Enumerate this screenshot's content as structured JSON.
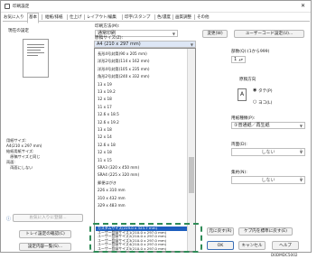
{
  "window": {
    "title": "印刷設定"
  },
  "tabs": [
    "お気に入り",
    "基本",
    "給紙/排紙",
    "仕上げ",
    "レイアウト/編集",
    "印字/スタンプ",
    "色/濃度",
    "画質調整",
    "その他"
  ],
  "current_settings": {
    "title": "現在の設定",
    "summary": "用紙サイズ:\nA4(210 x 297 mm)\n給紙用紙サイズ:\n　原稿サイズと同じ\n両面:\n　両面にしない",
    "favorite_button": "お気に入りに登録...",
    "saved_settings_button": "トレイ設定の確認(C)",
    "list_button": "設定内容一覧(S)..."
  },
  "job_type": {
    "label": "印刷方法(M):",
    "value": "通常印刷",
    "change_button": "変更(W)",
    "user_code_button": "ユーザーコード設定(U)..."
  },
  "paper_size": {
    "label": "原稿サイズ(Z):",
    "value": "A4 (210 x 297 mm)"
  },
  "paper_list": [
    "長形4号封筒(90 x 205 mm)",
    "洋形2号封筒(114 x 162 mm)",
    "洋形4号封筒(105 x 235 mm)",
    "角形2号封筒(240 x 332 mm)",
    "13 x 19",
    "13 x 19.2",
    "12 x 18",
    "11 x 17",
    "12.6 x 18.5",
    "12.6 x 19.2",
    "13 x 18",
    "12 x 14",
    "12.6 x 18",
    "12 x 18",
    "11 x 15",
    "SRA3 (320 x 450 mm)",
    "SRA4 (225 x 320 mm)",
    "郵便はがき",
    "226 x 310 mm",
    "310 x 432 mm",
    "329 x 483 mm"
  ],
  "custom_list": [
    "カスタムサイズ(229.0 x 323.7 mm)",
    "ユーザー登録サイズ1(210.0 x 297.0 mm)",
    "ユーザー登録サイズ2(210.0 x 297.0 mm)",
    "ユーザー登録サイズ3(210.0 x 297.0 mm)",
    "ユーザー登録サイズ4(210.0 x 297.0 mm)",
    "ユーザー登録サイズ5(210.0 x 297.0 mm)"
  ],
  "copies": {
    "label": "部数(Q):(1から999)",
    "value": "1"
  },
  "orientation": {
    "label": "原稿方向",
    "portrait": "タテ(P)",
    "landscape": "ヨコ(L)"
  },
  "paper_type": {
    "label": "用紙種類(P):",
    "value": "①普通紙／再生紙"
  },
  "duplex": {
    "label": "両面(D):",
    "value": "しない"
  },
  "layout": {
    "label": "集約(N):",
    "value": "しない"
  },
  "footer": {
    "restore_button": "元に戻す(R)",
    "defaults_button": "ケプ内を標準に戻す(E)",
    "ok": "OK",
    "cancel": "キャンセル",
    "help": "ヘルプ"
  },
  "figure_id": "D0DMDC5002"
}
